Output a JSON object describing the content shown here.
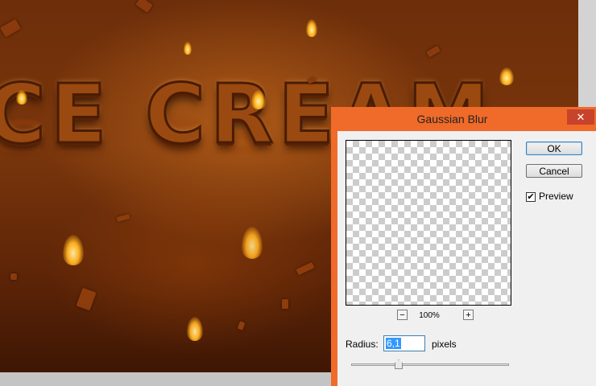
{
  "artwork": {
    "text": "ICE CREAM"
  },
  "dialog": {
    "title": "Gaussian Blur",
    "close_label": "✕",
    "ok_label": "OK",
    "cancel_label": "Cancel",
    "preview_label": "Preview",
    "preview_checked": true,
    "check_glyph": "✔",
    "zoom_out_label": "−",
    "zoom_in_label": "+",
    "zoom_level": "100%",
    "radius_label": "Radius:",
    "radius_value": "6,1",
    "radius_unit": "pixels",
    "radius_slider_fraction": 0.3
  },
  "colors": {
    "dialog_frame": "#f06a2a",
    "close_button": "#c7432b",
    "selection": "#3399ff"
  }
}
